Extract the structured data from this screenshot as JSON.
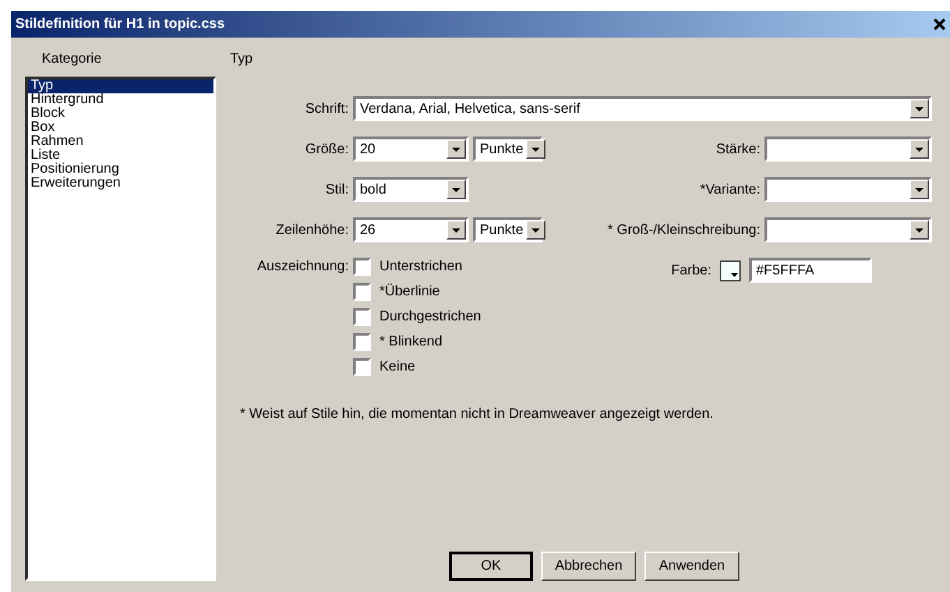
{
  "window": {
    "title": "Stildefinition für H1 in topic.css"
  },
  "sidebar": {
    "heading": "Kategorie",
    "items": [
      {
        "label": "Typ",
        "selected": true
      },
      {
        "label": "Hintergrund",
        "selected": false
      },
      {
        "label": "Block",
        "selected": false
      },
      {
        "label": "Box",
        "selected": false
      },
      {
        "label": "Rahmen",
        "selected": false
      },
      {
        "label": "Liste",
        "selected": false
      },
      {
        "label": "Positionierung",
        "selected": false
      },
      {
        "label": "Erweiterungen",
        "selected": false
      }
    ]
  },
  "panel": {
    "heading": "Typ",
    "font": {
      "label": "Schrift:",
      "value": "Verdana, Arial, Helvetica, sans-serif"
    },
    "size": {
      "label": "Größe:",
      "value": "20",
      "unit": "Punkte"
    },
    "weight": {
      "label": "Stärke:"
    },
    "style": {
      "label": "Stil:",
      "value": "bold"
    },
    "variant": {
      "label": "*Variante:"
    },
    "line_height": {
      "label": "Zeilenhöhe:",
      "value": "26",
      "unit": "Punkte"
    },
    "case": {
      "label": "* Groß-/Kleinschreibung:"
    },
    "decoration": {
      "label": "Auszeichnung:",
      "options": [
        {
          "label": "Unterstrichen",
          "checked": false
        },
        {
          "label": "*Überlinie",
          "checked": false
        },
        {
          "label": "Durchgestrichen",
          "checked": false
        },
        {
          "label": "* Blinkend",
          "checked": false
        },
        {
          "label": "Keine",
          "checked": false
        }
      ]
    },
    "color": {
      "label": "Farbe:",
      "value": "#F5FFFA"
    },
    "note": "* Weist auf Stile hin, die momentan nicht in Dreamweaver angezeigt werden."
  },
  "buttons": [
    {
      "label": "OK",
      "default": true
    },
    {
      "label": "Abbrechen",
      "default": false
    },
    {
      "label": "Anwenden",
      "default": false
    }
  ]
}
